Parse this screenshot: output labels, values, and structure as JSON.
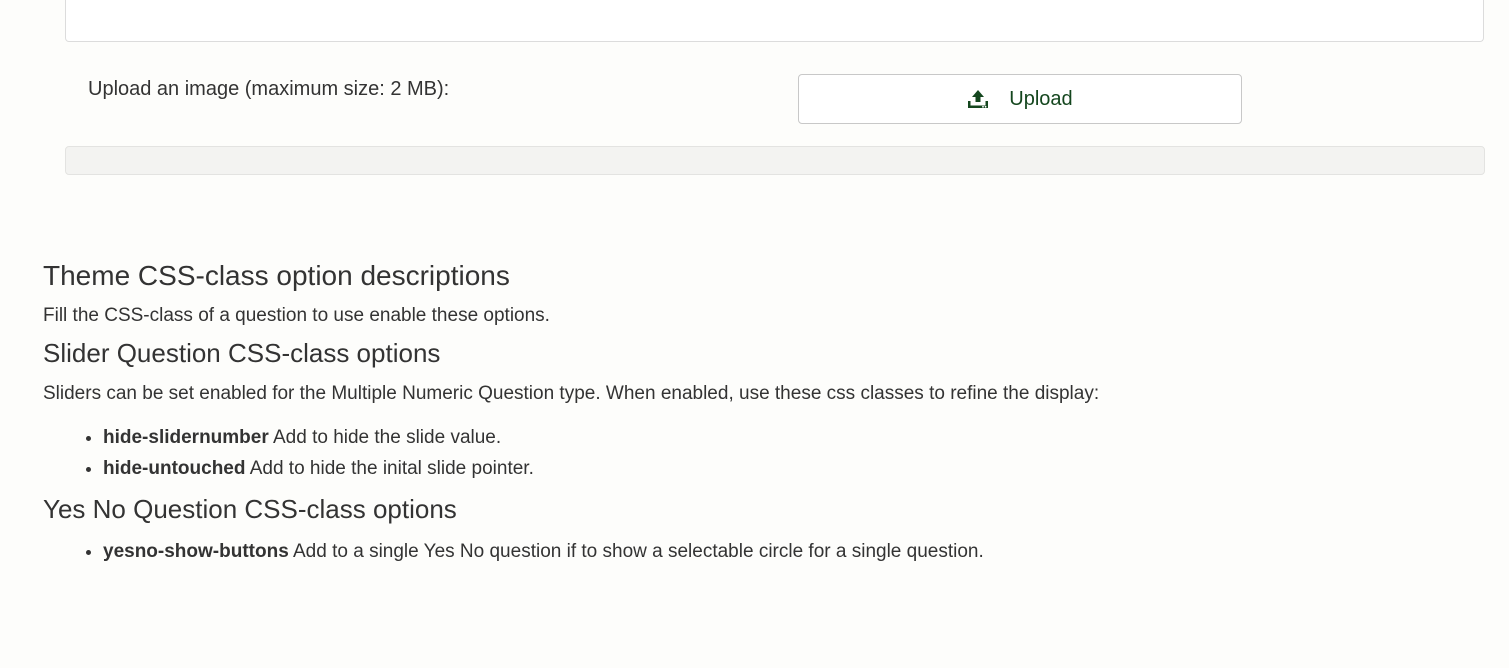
{
  "upload": {
    "label": "Upload an image (maximum size: 2 MB):",
    "button_label": "Upload",
    "button_icon": "upload-icon",
    "accent_color": "#14461e",
    "progress_percent": 0
  },
  "help": {
    "title": "Theme CSS-class option descriptions",
    "intro": "Fill the CSS-class of a question to use enable these options.",
    "slider": {
      "title": "Slider Question CSS-class options",
      "description": "Sliders can be set enabled for the Multiple Numeric Question type. When enabled, use these css classes to refine the display:",
      "options": [
        {
          "class_name": "hide-slidernumber",
          "text": " Add to hide the slide value."
        },
        {
          "class_name": "hide-untouched",
          "text": " Add to hide the inital slide pointer."
        }
      ]
    },
    "yesno": {
      "title": "Yes No Question CSS-class options",
      "options": [
        {
          "class_name": "yesno-show-buttons",
          "text": " Add to a single Yes No question if to show a selectable circle for a single question."
        }
      ]
    }
  }
}
